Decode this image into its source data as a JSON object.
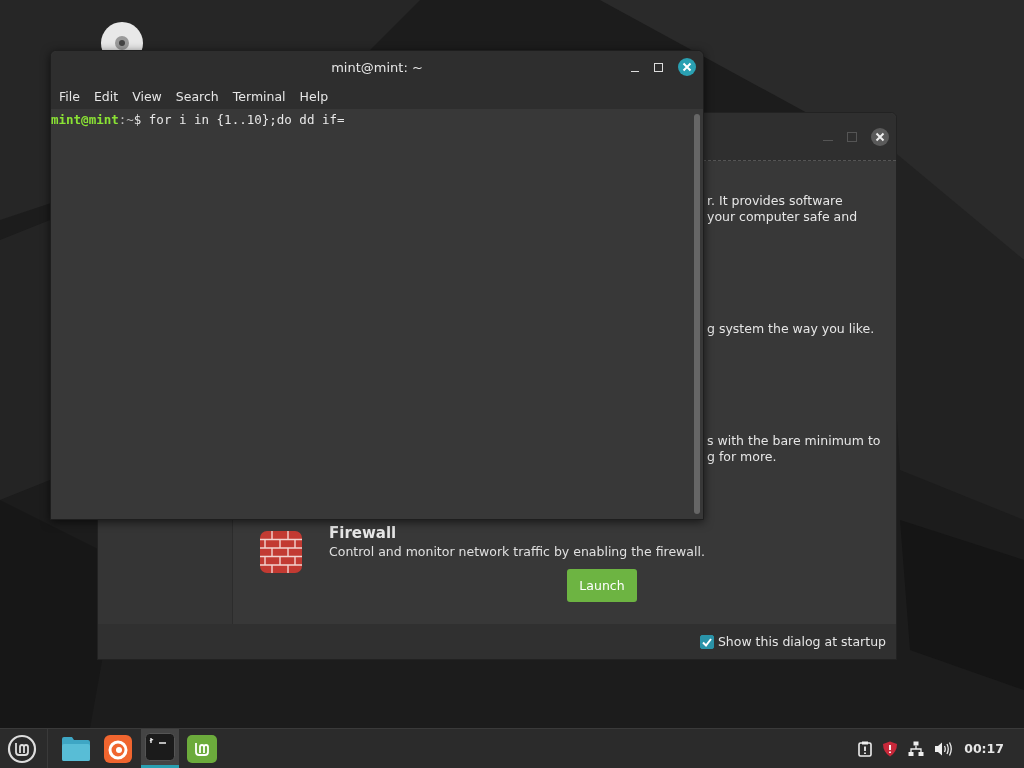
{
  "terminal": {
    "title": "mint@mint: ~",
    "menu": [
      "File",
      "Edit",
      "View",
      "Search",
      "Terminal",
      "Help"
    ],
    "prompt_user": "mint@mint",
    "prompt_path": ":~",
    "command": "$ for i in {1..10};do dd if="
  },
  "welcome": {
    "paragraphs": [
      "r. It provides software\nyour computer safe and",
      "g system the way you like.",
      "s with the bare minimum to\ng for more."
    ],
    "firewall": {
      "title": "Firewall",
      "description": "Control and monitor network traffic by enabling the firewall.",
      "button": "Launch"
    },
    "startup": {
      "label": "Show this dialog at startup",
      "checked": true
    }
  },
  "taskbar": {
    "apps": [
      {
        "kind": "files",
        "selected": false
      },
      {
        "kind": "firefox",
        "selected": false
      },
      {
        "kind": "terminal",
        "selected": true
      },
      {
        "kind": "mint",
        "selected": false
      }
    ],
    "clock": "00:17"
  }
}
